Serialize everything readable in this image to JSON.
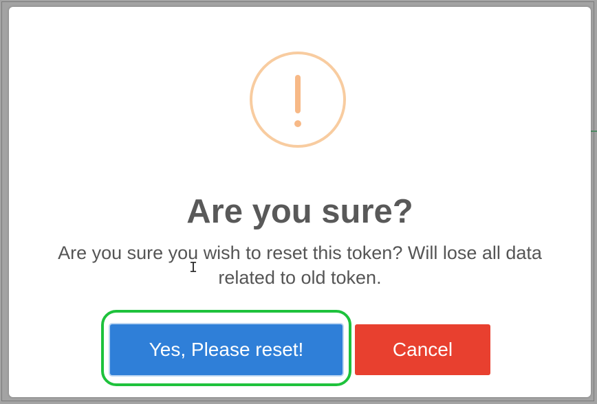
{
  "dialog": {
    "icon": "exclamation-warning-icon",
    "title": "Are you sure?",
    "message": "Are you sure you wish to reset this token? Will lose all data related to old token.",
    "confirm_label": "Yes, Please reset!",
    "cancel_label": "Cancel"
  },
  "colors": {
    "confirm_button": "#2f7fd8",
    "cancel_button": "#e8402f",
    "warning_icon": "#f7b987",
    "highlight": "#1ec23c"
  }
}
